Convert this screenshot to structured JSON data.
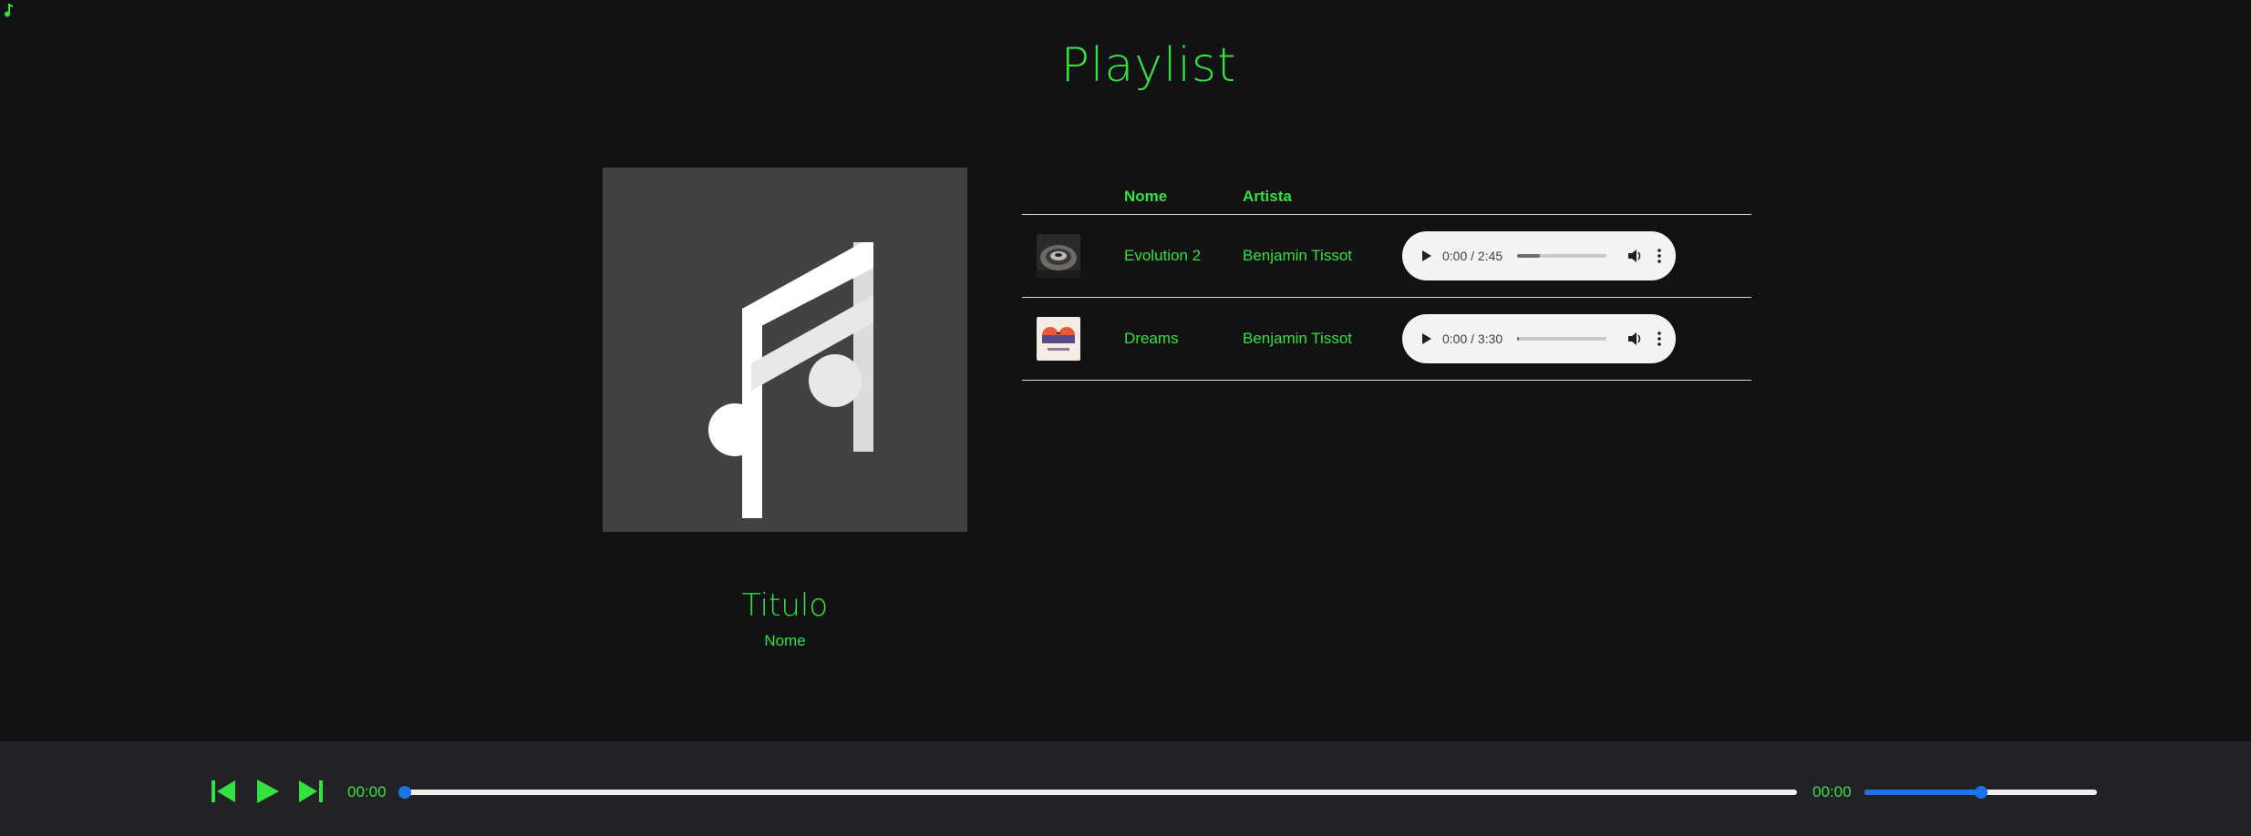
{
  "page": {
    "title": "Playlist",
    "favicon_icon": "music-note-icon"
  },
  "now_playing": {
    "cover_icon": "music-note-icon",
    "title": "Titulo",
    "name": "Nome"
  },
  "playlist": {
    "headers": [
      "",
      "Nome",
      "Artista",
      ""
    ],
    "tracks": [
      {
        "name": "Evolution 2",
        "artist": "Benjamin Tissot",
        "thumbnail": "evolution-cover",
        "audio_time": "0:00 / 2:45",
        "buffered": 0.25
      },
      {
        "name": "Dreams",
        "artist": "Benjamin Tissot",
        "thumbnail": "dreams-cover",
        "audio_time": "0:00 / 3:30",
        "buffered": 0.02
      }
    ]
  },
  "player": {
    "prev_icon": "skip-previous-icon",
    "play_icon": "play-icon",
    "next_icon": "skip-next-icon",
    "current_time": "00:00",
    "duration": "00:00",
    "progress": 0,
    "volume": 0.5
  },
  "colors": {
    "accent": "#33e23f",
    "background": "#121214",
    "player_bar": "#222226",
    "slider": "#1a73e8"
  }
}
